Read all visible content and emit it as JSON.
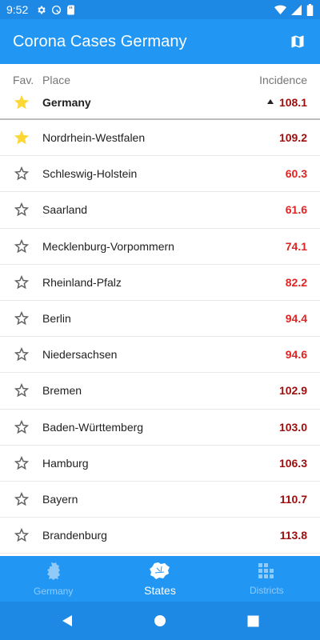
{
  "status_bar": {
    "time": "9:52",
    "left_icons": [
      "settings-icon",
      "at-sign-icon",
      "sd-card-icon"
    ],
    "right_icons": [
      "wifi-icon",
      "signal-icon",
      "battery-icon"
    ]
  },
  "app_bar": {
    "title": "Corona Cases Germany",
    "action_icon": "map-icon"
  },
  "table_header": {
    "fav_label": "Fav.",
    "place_label": "Place",
    "incidence_label": "Incidence",
    "total": {
      "name": "Germany",
      "value": "108.1",
      "trend": "up",
      "favorite": true
    }
  },
  "rows": [
    {
      "name": "Nordrhein-Westfalen",
      "value": "109.2",
      "favorite": true,
      "color": "#9c0e0e"
    },
    {
      "name": "Schleswig-Holstein",
      "value": "60.3",
      "favorite": false,
      "color": "#e02424"
    },
    {
      "name": "Saarland",
      "value": "61.6",
      "favorite": false,
      "color": "#e02424"
    },
    {
      "name": "Mecklenburg-Vorpommern",
      "value": "74.1",
      "favorite": false,
      "color": "#e02424"
    },
    {
      "name": "Rheinland-Pfalz",
      "value": "82.2",
      "favorite": false,
      "color": "#e02424"
    },
    {
      "name": "Berlin",
      "value": "94.4",
      "favorite": false,
      "color": "#e02424"
    },
    {
      "name": "Niedersachsen",
      "value": "94.6",
      "favorite": false,
      "color": "#e02424"
    },
    {
      "name": "Bremen",
      "value": "102.9",
      "favorite": false,
      "color": "#9c0e0e"
    },
    {
      "name": "Baden-Württemberg",
      "value": "103.0",
      "favorite": false,
      "color": "#9c0e0e"
    },
    {
      "name": "Hamburg",
      "value": "106.3",
      "favorite": false,
      "color": "#9c0e0e"
    },
    {
      "name": "Bayern",
      "value": "110.7",
      "favorite": false,
      "color": "#9c0e0e"
    },
    {
      "name": "Brandenburg",
      "value": "113.8",
      "favorite": false,
      "color": "#9c0e0e"
    }
  ],
  "bottom_nav": {
    "items": [
      {
        "label": "Germany",
        "icon": "germany-map-icon",
        "active": false
      },
      {
        "label": "States",
        "icon": "states-map-icon",
        "active": true
      },
      {
        "label": "Districts",
        "icon": "districts-grid-icon",
        "active": false
      }
    ]
  },
  "system_nav": [
    "back-icon",
    "home-icon",
    "recents-icon"
  ],
  "colors": {
    "primary": "#2196f3",
    "status_bar": "#1e88e5",
    "star_filled": "#fdd835",
    "value_high": "#9c0e0e",
    "value_mid": "#e02424"
  }
}
